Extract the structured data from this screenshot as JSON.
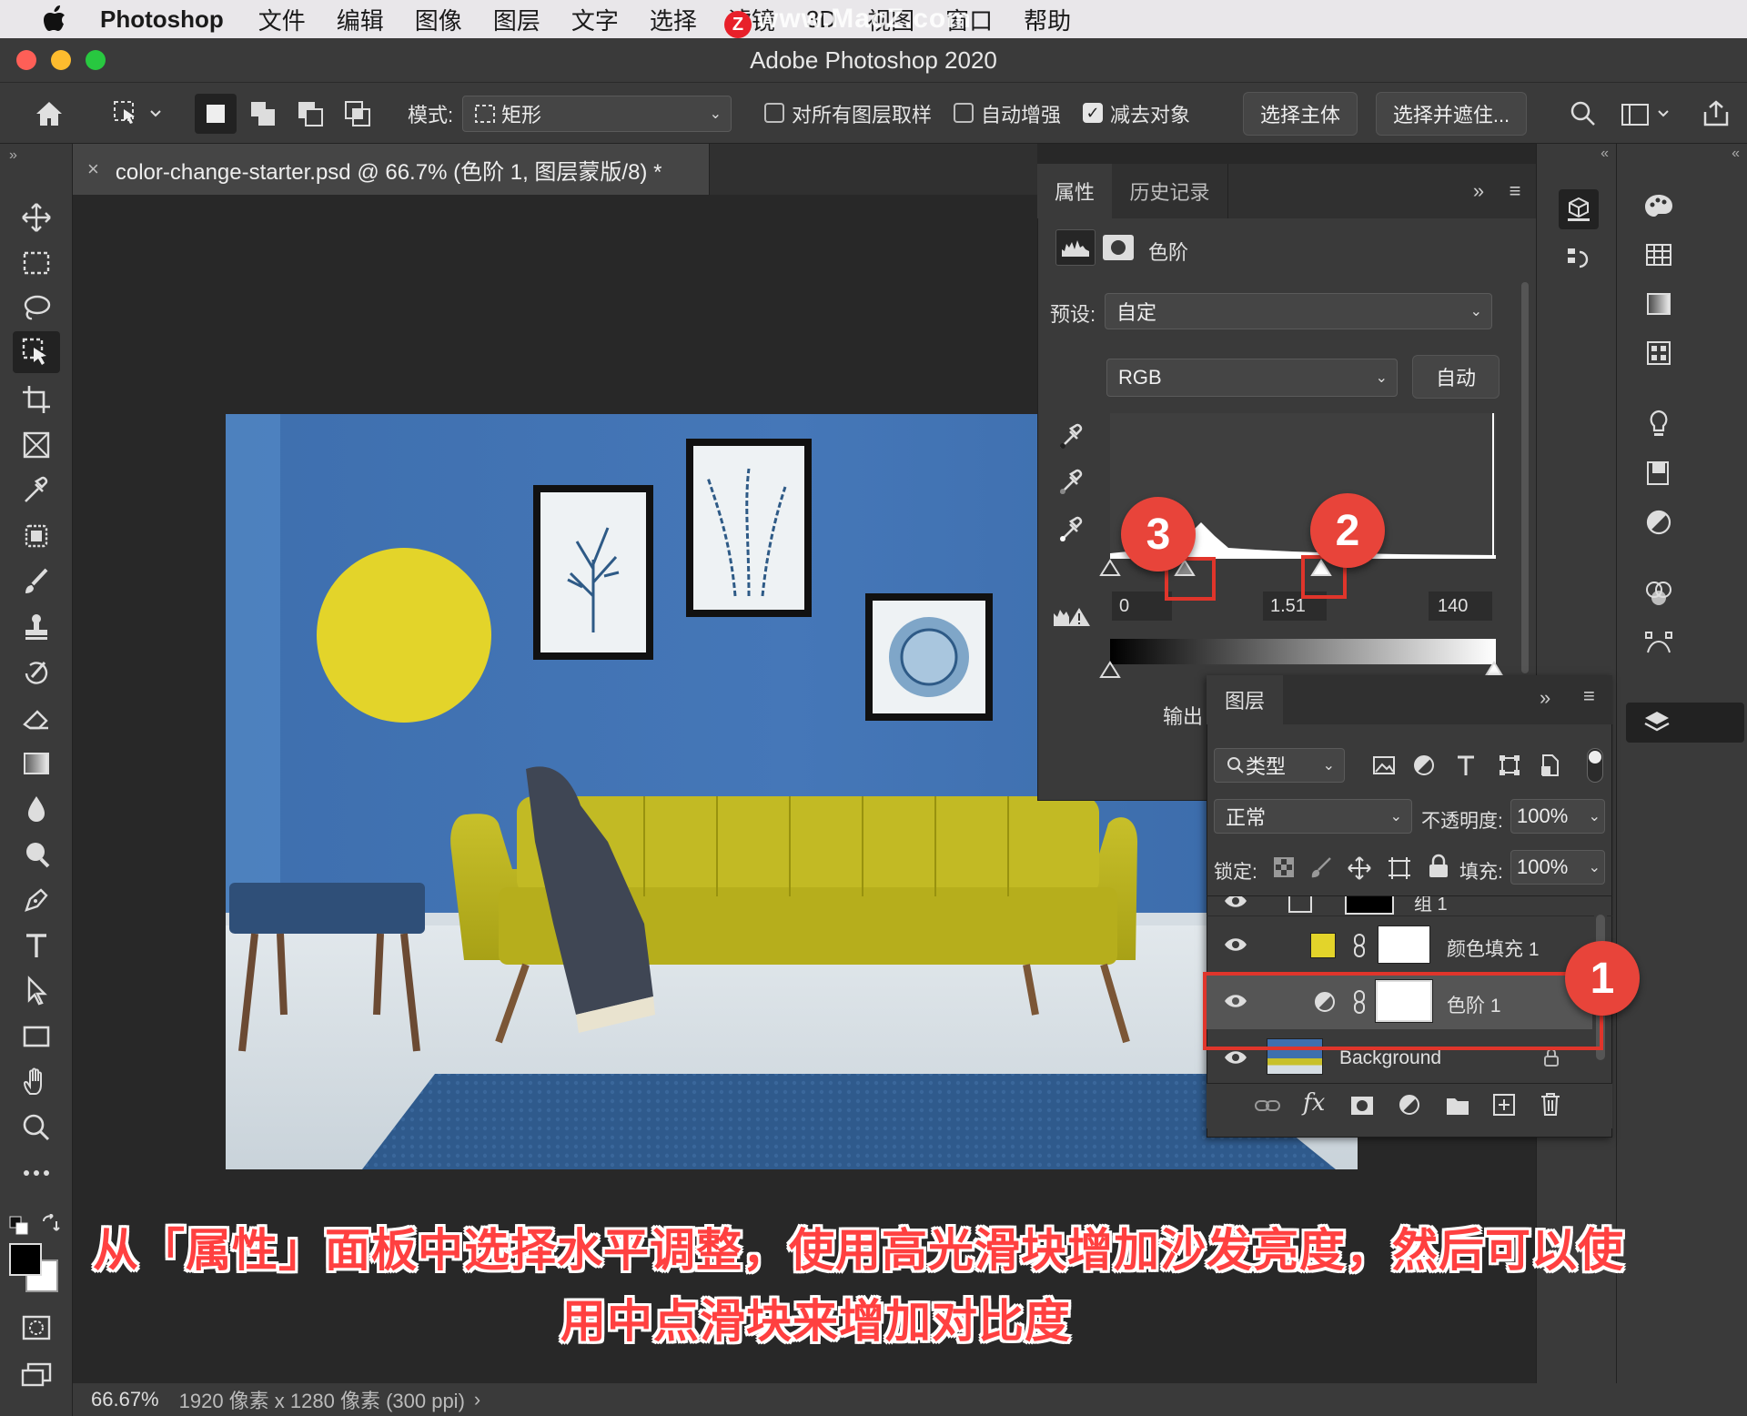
{
  "menubar": {
    "app_name": "Photoshop",
    "items": [
      "文件",
      "编辑",
      "图像",
      "图层",
      "文字",
      "选择",
      "滤镜",
      "3D",
      "视图",
      "窗口",
      "帮助"
    ],
    "watermark": "www.MacZ.com",
    "watermark_badge": "Z"
  },
  "window": {
    "title": "Adobe Photoshop 2020"
  },
  "options_bar": {
    "mode_label": "模式:",
    "mode_value": "矩形",
    "sample_all_layers": "对所有图层取样",
    "auto_enhance": "自动增强",
    "subtract_object": "减去对象",
    "select_subject": "选择主体",
    "select_and_mask": "选择并遮住..."
  },
  "document": {
    "tab_title": "color-change-starter.psd @ 66.7% (色阶 1, 图层蒙版/8) *",
    "zoom": "66.67%",
    "info": "1920 像素 x 1280 像素 (300 ppi)"
  },
  "properties_panel": {
    "tab_properties": "属性",
    "tab_history": "历史记录",
    "adjustment_name": "色阶",
    "preset_label": "预设:",
    "preset_value": "自定",
    "channel_value": "RGB",
    "auto_button": "自动",
    "input_black": "0",
    "input_mid": "1.51",
    "input_white": "140",
    "output_label": "输出"
  },
  "layers_panel": {
    "title": "图层",
    "filter_kind": "类型",
    "blend_mode": "正常",
    "opacity_label": "不透明度:",
    "opacity_value": "100%",
    "lock_label": "锁定:",
    "fill_label": "填充:",
    "fill_value": "100%",
    "layers": [
      {
        "name": "组 1"
      },
      {
        "name": "颜色填充 1",
        "swatch": "#e3d42a"
      },
      {
        "name": "色阶 1",
        "selected": true
      },
      {
        "name": "Background"
      }
    ]
  },
  "callouts": [
    "1",
    "2",
    "3"
  ],
  "caption": {
    "line1": "从「属性」面板中选择水平调整，使用高光滑块增加沙发亮度，然后可以使",
    "line2": "用中点滑块来增加对比度"
  },
  "colors": {
    "accent_red": "#e8443a",
    "caption_red": "#ff4040",
    "panel_bg": "#3a3a3a",
    "canvas_bg": "#282828"
  }
}
